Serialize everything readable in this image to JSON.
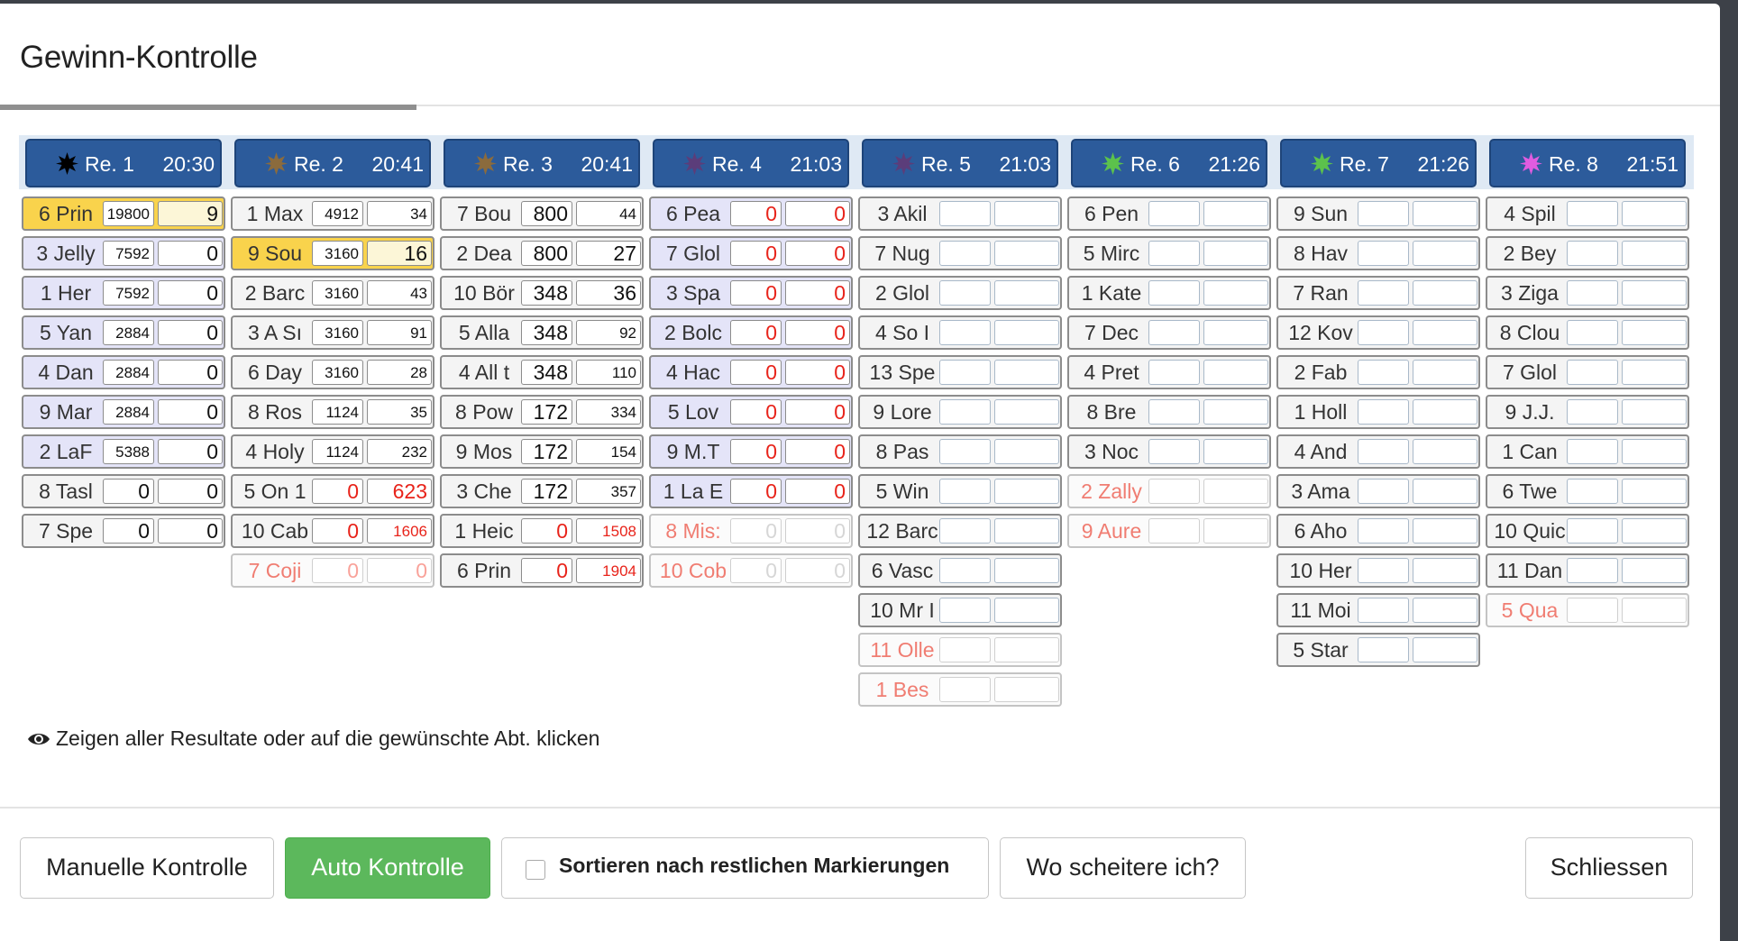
{
  "modal": {
    "title": "Gewinn-Kontrolle"
  },
  "races": [
    {
      "name": "Re. 1",
      "time": "20:30",
      "star_color": "#000000",
      "rows": [
        {
          "horse": "6 Prin",
          "v1": "19800",
          "v2": "9",
          "state": "winner",
          "v1_small": true,
          "v2_highlight": true
        },
        {
          "horse": "3 Jelly",
          "v1": "7592",
          "v2": "0",
          "v1_small": true
        },
        {
          "horse": "1 Her",
          "v1": "7592",
          "v2": "0",
          "v1_small": true
        },
        {
          "horse": "5 Yan",
          "v1": "2884",
          "v2": "0",
          "v1_small": true
        },
        {
          "horse": "4 Dan",
          "v1": "2884",
          "v2": "0",
          "v1_small": true
        },
        {
          "horse": "9 Mar",
          "v1": "2884",
          "v2": "0",
          "v1_small": true
        },
        {
          "horse": "2 LaF",
          "v1": "5388",
          "v2": "0",
          "v1_small": true
        },
        {
          "horse": "8 Tasl",
          "v1": "0",
          "v2": "0",
          "state": "neutral"
        },
        {
          "horse": "7 Spe",
          "v1": "0",
          "v2": "0",
          "state": "neutral"
        }
      ]
    },
    {
      "name": "Re. 2",
      "time": "20:41",
      "star_color": "#8b6b3d",
      "rows": [
        {
          "horse": "1 Max",
          "v1": "4912",
          "v2": "34",
          "v1_small": true,
          "v2_small": true,
          "state": "neutral"
        },
        {
          "horse": "9 Sou",
          "v1": "3160",
          "v2": "16",
          "state": "winner",
          "v1_small": true,
          "v2_highlight": true
        },
        {
          "horse": "2 Barc",
          "v1": "3160",
          "v2": "43",
          "v1_small": true,
          "v2_small": true,
          "state": "neutral"
        },
        {
          "horse": "3 A Sı",
          "v1": "3160",
          "v2": "91",
          "v1_small": true,
          "v2_small": true,
          "state": "neutral"
        },
        {
          "horse": "6 Day",
          "v1": "3160",
          "v2": "28",
          "v1_small": true,
          "v2_small": true,
          "state": "neutral"
        },
        {
          "horse": "8 Ros",
          "v1": "1124",
          "v2": "35",
          "v1_small": true,
          "v2_small": true,
          "state": "neutral"
        },
        {
          "horse": "4 Holy",
          "v1": "1124",
          "v2": "232",
          "v1_small": true,
          "v2_small": true,
          "state": "neutral"
        },
        {
          "horse": "5 On 1",
          "v1": "0",
          "v2": "623",
          "red": true,
          "state": "neutral"
        },
        {
          "horse": "10 Cab",
          "v1": "0",
          "v2": "1606",
          "red": true,
          "v2_small": true,
          "state": "neutral"
        },
        {
          "horse": "7 Coji",
          "v1": "0",
          "v2": "0",
          "state": "scratched",
          "dimred": true
        }
      ]
    },
    {
      "name": "Re. 3",
      "time": "20:41",
      "star_color": "#8b6b3d",
      "rows": [
        {
          "horse": "7 Bou",
          "v1": "800",
          "v2": "44",
          "v2_small": true,
          "state": "neutral"
        },
        {
          "horse": "2 Dea",
          "v1": "800",
          "v2": "27",
          "state": "neutral"
        },
        {
          "horse": "10 Bör",
          "v1": "348",
          "v2": "36",
          "state": "neutral"
        },
        {
          "horse": "5 Alla",
          "v1": "348",
          "v2": "92",
          "v2_small": true,
          "state": "neutral"
        },
        {
          "horse": "4 All t",
          "v1": "348",
          "v2": "110",
          "v2_small": true,
          "state": "neutral"
        },
        {
          "horse": "8 Pow",
          "v1": "172",
          "v2": "334",
          "v2_small": true,
          "state": "neutral"
        },
        {
          "horse": "9 Mos",
          "v1": "172",
          "v2": "154",
          "v2_small": true,
          "state": "neutral"
        },
        {
          "horse": "3 Che",
          "v1": "172",
          "v2": "357",
          "v2_small": true,
          "state": "neutral"
        },
        {
          "horse": "1 Heic",
          "v1": "0",
          "v2": "1508",
          "red": true,
          "v2_small": true,
          "state": "neutral"
        },
        {
          "horse": "6 Prin",
          "v1": "0",
          "v2": "1904",
          "red": true,
          "v2_small": true,
          "state": "neutral"
        }
      ]
    },
    {
      "name": "Re. 4",
      "time": "21:03",
      "star_color": "#5b3d7a",
      "rows": [
        {
          "horse": "6 Pea",
          "v1": "0",
          "v2": "0",
          "red": true
        },
        {
          "horse": "7 Glol",
          "v1": "0",
          "v2": "0",
          "red": true
        },
        {
          "horse": "3 Spa",
          "v1": "0",
          "v2": "0",
          "red": true
        },
        {
          "horse": "2 Bolc",
          "v1": "0",
          "v2": "0",
          "red": true
        },
        {
          "horse": "4 Hac",
          "v1": "0",
          "v2": "0",
          "red": true
        },
        {
          "horse": "5 Lov",
          "v1": "0",
          "v2": "0",
          "red": true
        },
        {
          "horse": "9 M.T",
          "v1": "0",
          "v2": "0",
          "red": true
        },
        {
          "horse": "1 La E",
          "v1": "0",
          "v2": "0",
          "red": true
        },
        {
          "horse": "8 Mis:",
          "v1": "0",
          "v2": "0",
          "state": "scratched",
          "ghost": true
        },
        {
          "horse": "10 Cob",
          "v1": "0",
          "v2": "0",
          "state": "scratched",
          "ghost": true
        }
      ]
    },
    {
      "name": "Re. 5",
      "time": "21:03",
      "star_color": "#5b3d7a",
      "rows": [
        {
          "horse": "3 Akil",
          "empty": true,
          "state": "neutral"
        },
        {
          "horse": "7 Nug",
          "empty": true,
          "state": "neutral"
        },
        {
          "horse": "2 Glol",
          "empty": true,
          "state": "neutral"
        },
        {
          "horse": "4 So I",
          "empty": true,
          "state": "neutral"
        },
        {
          "horse": "13 Spe",
          "empty": true,
          "state": "neutral"
        },
        {
          "horse": "9 Lore",
          "empty": true,
          "state": "neutral"
        },
        {
          "horse": "8 Pas",
          "empty": true,
          "state": "neutral"
        },
        {
          "horse": "5 Win",
          "empty": true,
          "state": "neutral"
        },
        {
          "horse": "12 Barc",
          "empty": true,
          "state": "neutral"
        },
        {
          "horse": "6 Vasc",
          "empty": true,
          "state": "neutral"
        },
        {
          "horse": "10 Mr I",
          "empty": true,
          "state": "neutral"
        },
        {
          "horse": "11 Olle",
          "empty": true,
          "state": "scratched"
        },
        {
          "horse": "1 Bes",
          "empty": true,
          "state": "scratched"
        }
      ]
    },
    {
      "name": "Re. 6",
      "time": "21:26",
      "star_color": "#5cc24c",
      "rows": [
        {
          "horse": "6 Pen",
          "empty": true,
          "state": "neutral"
        },
        {
          "horse": "5 Mirc",
          "empty": true,
          "state": "neutral"
        },
        {
          "horse": "1 Kate",
          "empty": true,
          "state": "neutral"
        },
        {
          "horse": "7 Dec",
          "empty": true,
          "state": "neutral"
        },
        {
          "horse": "4 Pret",
          "empty": true,
          "state": "neutral"
        },
        {
          "horse": "8 Bre",
          "empty": true,
          "state": "neutral"
        },
        {
          "horse": "3 Noc",
          "empty": true,
          "state": "neutral"
        },
        {
          "horse": "2 Zally",
          "empty": true,
          "state": "scratched"
        },
        {
          "horse": "9 Aure",
          "empty": true,
          "state": "scratched"
        }
      ]
    },
    {
      "name": "Re. 7",
      "time": "21:26",
      "star_color": "#5cc24c",
      "rows": [
        {
          "horse": "9 Sun",
          "empty": true,
          "state": "neutral"
        },
        {
          "horse": "8 Hav",
          "empty": true,
          "state": "neutral"
        },
        {
          "horse": "7 Ran",
          "empty": true,
          "state": "neutral"
        },
        {
          "horse": "12 Kov",
          "empty": true,
          "state": "neutral"
        },
        {
          "horse": "2 Fab",
          "empty": true,
          "state": "neutral"
        },
        {
          "horse": "1 Holl",
          "empty": true,
          "state": "neutral"
        },
        {
          "horse": "4 And",
          "empty": true,
          "state": "neutral"
        },
        {
          "horse": "3 Ama",
          "empty": true,
          "state": "neutral"
        },
        {
          "horse": "6 Aho",
          "empty": true,
          "state": "neutral"
        },
        {
          "horse": "10 Her",
          "empty": true,
          "state": "neutral"
        },
        {
          "horse": "11 Moi",
          "empty": true,
          "state": "neutral"
        },
        {
          "horse": "5 Star",
          "empty": true,
          "state": "neutral"
        }
      ]
    },
    {
      "name": "Re. 8",
      "time": "21:51",
      "star_color": "#e05ce0",
      "rows": [
        {
          "horse": "4 Spil",
          "empty": true,
          "state": "neutral"
        },
        {
          "horse": "2 Bey",
          "empty": true,
          "state": "neutral"
        },
        {
          "horse": "3 Ziga",
          "empty": true,
          "state": "neutral"
        },
        {
          "horse": "8 Clou",
          "empty": true,
          "state": "neutral"
        },
        {
          "horse": "7 Glol",
          "empty": true,
          "state": "neutral"
        },
        {
          "horse": "9 J.J.",
          "empty": true,
          "state": "neutral"
        },
        {
          "horse": "1 Can",
          "empty": true,
          "state": "neutral"
        },
        {
          "horse": "6 Twe",
          "empty": true,
          "state": "neutral"
        },
        {
          "horse": "10 Quic",
          "empty": true,
          "state": "neutral"
        },
        {
          "horse": "11 Dan",
          "empty": true,
          "state": "neutral"
        },
        {
          "horse": "5 Qua",
          "empty": true,
          "state": "scratched"
        }
      ]
    }
  ],
  "info": {
    "icon": "eye-icon",
    "text": "Zeigen aller Resultate oder auf die gewünschte Abt. klicken"
  },
  "footer": {
    "manual_label": "Manuelle Kontrolle",
    "auto_label": "Auto Kontrolle",
    "sort_label": "Sortieren nach restlichen Markierungen",
    "fail_label": "Wo scheitere ich?",
    "close_label": "Schliessen",
    "auto_color": "#5cb85c"
  }
}
